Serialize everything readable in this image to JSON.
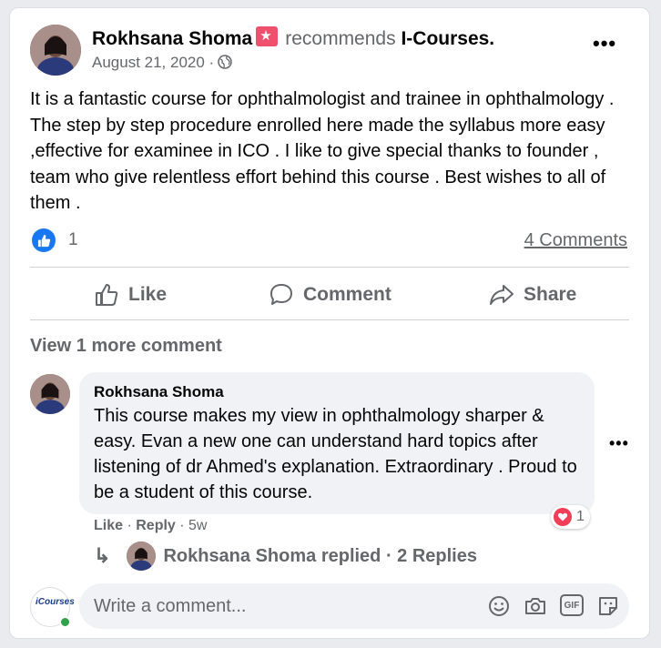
{
  "post": {
    "author": "Rokhsana Shoma",
    "action": "recommends",
    "page": "I-Courses.",
    "date": "August 21, 2020 ·",
    "text": "It is a fantastic course for ophthalmologist and trainee in ophthalmology . The step by step procedure enrolled here made the syllabus more easy ,effective for examinee in ICO . I like to give special thanks to founder , team who give relentless effort  behind this course . Best wishes to all of them .",
    "like_count": "1",
    "comments_link": "4 Comments",
    "more_icon": "•••"
  },
  "actions": {
    "like": "Like",
    "comment": "Comment",
    "share": "Share"
  },
  "view_more": "View 1 more comment",
  "comment": {
    "author": "Rokhsana Shoma",
    "text": "This course makes my view in ophthalmology sharper & easy. Evan a new one can understand hard topics after listening of dr Ahmed's explanation. Extraordinary . Proud to be a student of this course.",
    "like": "Like",
    "separator": " · ",
    "reply": "Reply",
    "time": " · 5w",
    "reaction_count": "1",
    "more_icon": "•••"
  },
  "reply": {
    "arrow": "↳",
    "text": "Rokhsana Shoma replied · 2 Replies"
  },
  "composer": {
    "placeholder": "Write a comment...",
    "logo_text": "iCourses",
    "gif_label": "GIF"
  },
  "colors": {
    "accent": "#1877f2",
    "heart": "#f33e58",
    "secondary_text": "#65676b",
    "online": "#31a24c"
  },
  "icons": [
    "globe-icon",
    "like-icon",
    "comment-icon",
    "share-icon",
    "emoji-icon",
    "camera-icon",
    "gif-icon",
    "sticker-icon",
    "heart-icon",
    "more-icon"
  ]
}
